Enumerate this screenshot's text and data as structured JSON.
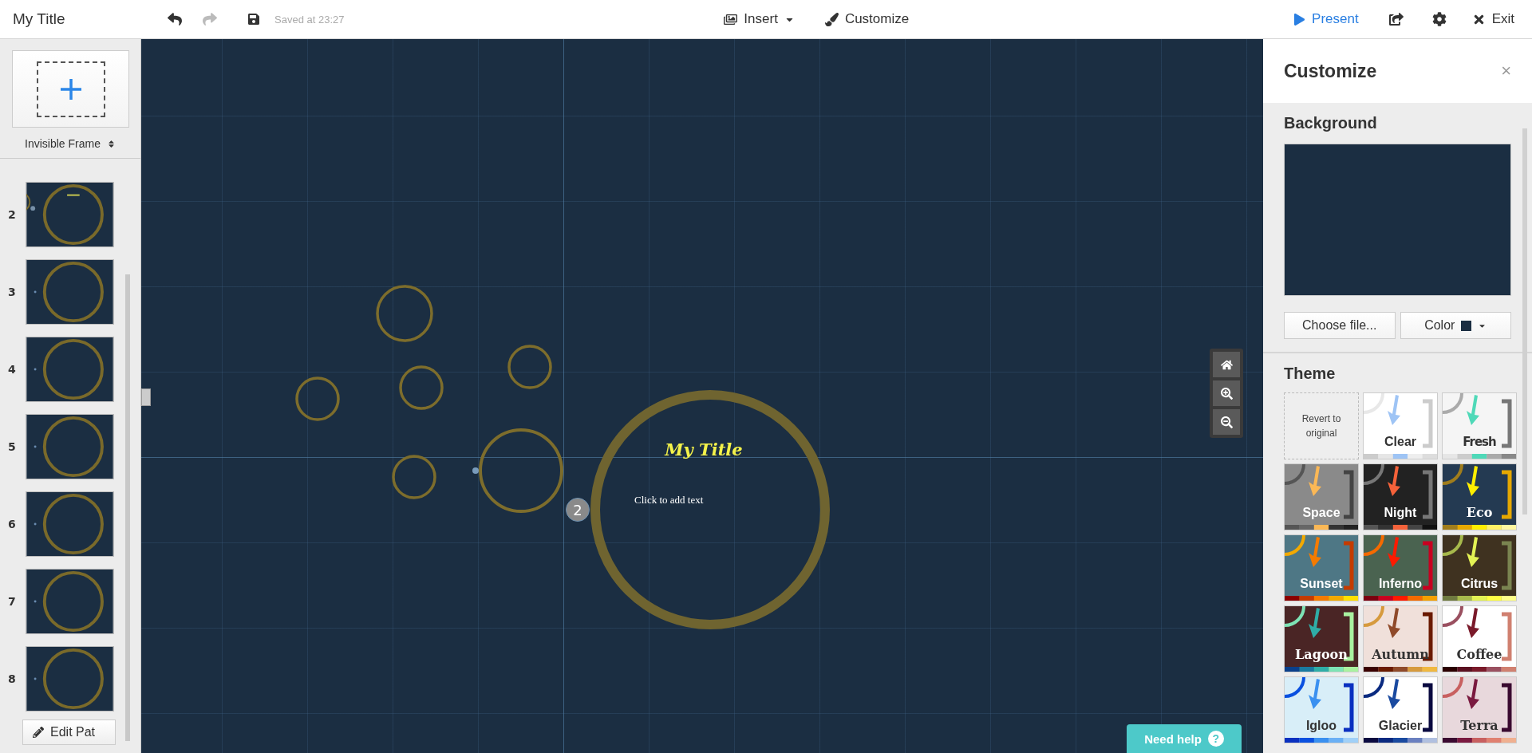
{
  "header": {
    "title": "My Title",
    "saved_status": "Saved at 23:27",
    "insert_label": "Insert",
    "customize_label": "Customize",
    "present_label": "Present",
    "exit_label": "Exit"
  },
  "sidebar": {
    "frame_type": "Invisible Frame",
    "steps": [
      {
        "number": "2",
        "kind": "title"
      },
      {
        "number": "3",
        "kind": "frame"
      },
      {
        "number": "4",
        "kind": "frame"
      },
      {
        "number": "5",
        "kind": "frame"
      },
      {
        "number": "6",
        "kind": "frame"
      },
      {
        "number": "7",
        "kind": "frame"
      },
      {
        "number": "8",
        "kind": "frame"
      }
    ],
    "edit_path_label": "Edit Pat"
  },
  "canvas": {
    "title": "My Title",
    "body_placeholder": "Click to add text",
    "step_badge": "2",
    "help_label": "Need help",
    "help_icon": "?"
  },
  "customize": {
    "title": "Customize",
    "close_icon": "×",
    "background": {
      "heading": "Background",
      "color": "#1b2e42",
      "choose_file_label": "Choose file...",
      "color_label": "Color"
    },
    "theme": {
      "heading": "Theme",
      "items": [
        {
          "kind": "revert",
          "label": "Revert to original"
        },
        {
          "kind": "theme",
          "label": "Clear",
          "color": "#ffffff"
        },
        {
          "kind": "theme",
          "label": "Fresh",
          "color": "#f5f5f5"
        },
        {
          "kind": "theme",
          "label": "Space",
          "color": "#8a8a8a"
        },
        {
          "kind": "theme",
          "label": "Night",
          "color": "#222222"
        },
        {
          "kind": "theme",
          "label": "Eco",
          "color": "#243a52"
        },
        {
          "kind": "theme",
          "label": "Sunset",
          "color": "#4e7785"
        },
        {
          "kind": "theme",
          "label": "Inferno",
          "color": "#4a6350"
        },
        {
          "kind": "theme",
          "label": "Citrus",
          "color": "#3f3220"
        },
        {
          "kind": "theme",
          "label": "Lagoon",
          "color": "#4a2525"
        },
        {
          "kind": "theme",
          "label": "Autumn",
          "color": "#f0e0da"
        },
        {
          "kind": "theme",
          "label": "Coffee",
          "color": "#ffffff"
        },
        {
          "kind": "theme",
          "label": "Igloo",
          "color": "#d8eef8"
        },
        {
          "kind": "theme",
          "label": "Glacier",
          "color": "#ffffff"
        },
        {
          "kind": "theme",
          "label": "Terra",
          "color": "#e8d8dc"
        }
      ]
    }
  }
}
